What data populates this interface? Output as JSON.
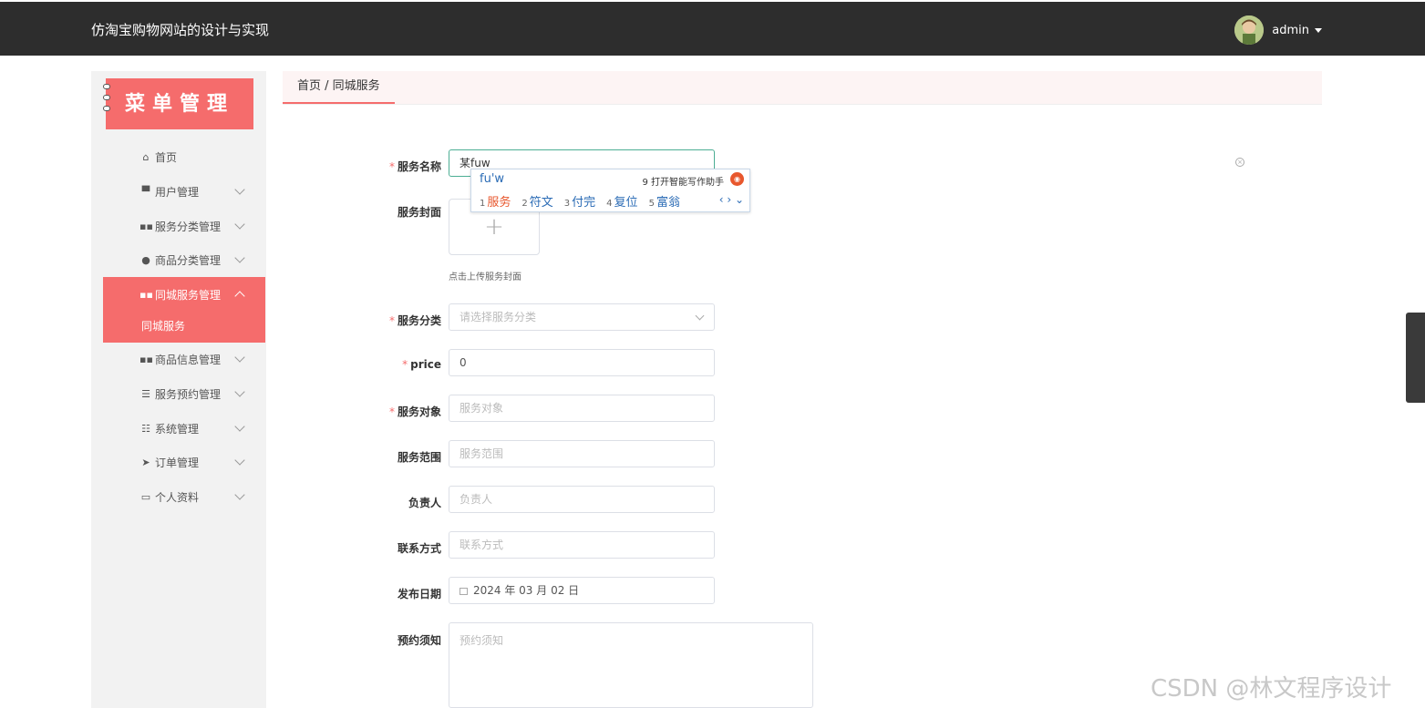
{
  "header": {
    "site_title": "仿淘宝购物网站的设计与实现",
    "user_name": "admin",
    "avatar_icon": "user-avatar-icon"
  },
  "sidebar": {
    "banner_title": "菜单管理",
    "items": [
      {
        "label": "首页",
        "icon": "home-icon"
      },
      {
        "label": "用户管理",
        "icon": "monitor-icon"
      },
      {
        "label": "服务分类管理",
        "icon": "grid-icon"
      },
      {
        "label": "商品分类管理",
        "icon": "user-icon"
      },
      {
        "label": "同城服务管理",
        "icon": "grid-icon"
      },
      {
        "label": "商品信息管理",
        "icon": "grid-icon"
      },
      {
        "label": "服务预约管理",
        "icon": "list-icon"
      },
      {
        "label": "系统管理",
        "icon": "sliders-icon"
      },
      {
        "label": "订单管理",
        "icon": "send-icon"
      },
      {
        "label": "个人资料",
        "icon": "card-icon"
      }
    ],
    "active_sub_item": "同城服务"
  },
  "breadcrumb": {
    "text": "首页 / 同城服务"
  },
  "form": {
    "service_name": {
      "label": "服务名称",
      "required": true,
      "value": "某fuw"
    },
    "cover": {
      "label": "服务封面",
      "tip": "点击上传服务封面"
    },
    "category": {
      "label": "服务分类",
      "required": true,
      "placeholder": "请选择服务分类"
    },
    "price": {
      "label": "price",
      "required": true,
      "value": "0"
    },
    "target": {
      "label": "服务对象",
      "required": true,
      "placeholder": "服务对象"
    },
    "scope": {
      "label": "服务范围",
      "placeholder": "服务范围"
    },
    "owner": {
      "label": "负责人",
      "placeholder": "负责人"
    },
    "contact": {
      "label": "联系方式",
      "placeholder": "联系方式"
    },
    "publish_date": {
      "label": "发布日期",
      "value": "2024 年 03 月 02 日"
    },
    "notice": {
      "label": "预约须知",
      "placeholder": "预约须知"
    }
  },
  "ime": {
    "composition": "fu'w",
    "helper": "9 打开智能写作助手",
    "candidates": [
      {
        "n": "1",
        "text": "服务"
      },
      {
        "n": "2",
        "text": "符文"
      },
      {
        "n": "3",
        "text": "付完"
      },
      {
        "n": "4",
        "text": "复位"
      },
      {
        "n": "5",
        "text": "富翁"
      }
    ],
    "nav": "‹ › ⌄"
  },
  "watermark": "CSDN @林文程序设计",
  "colors": {
    "accent": "#f56c6c",
    "topbar": "#2d2d2d",
    "sidebar_bg": "#f2f2f2",
    "focus_border": "#4cae94"
  }
}
